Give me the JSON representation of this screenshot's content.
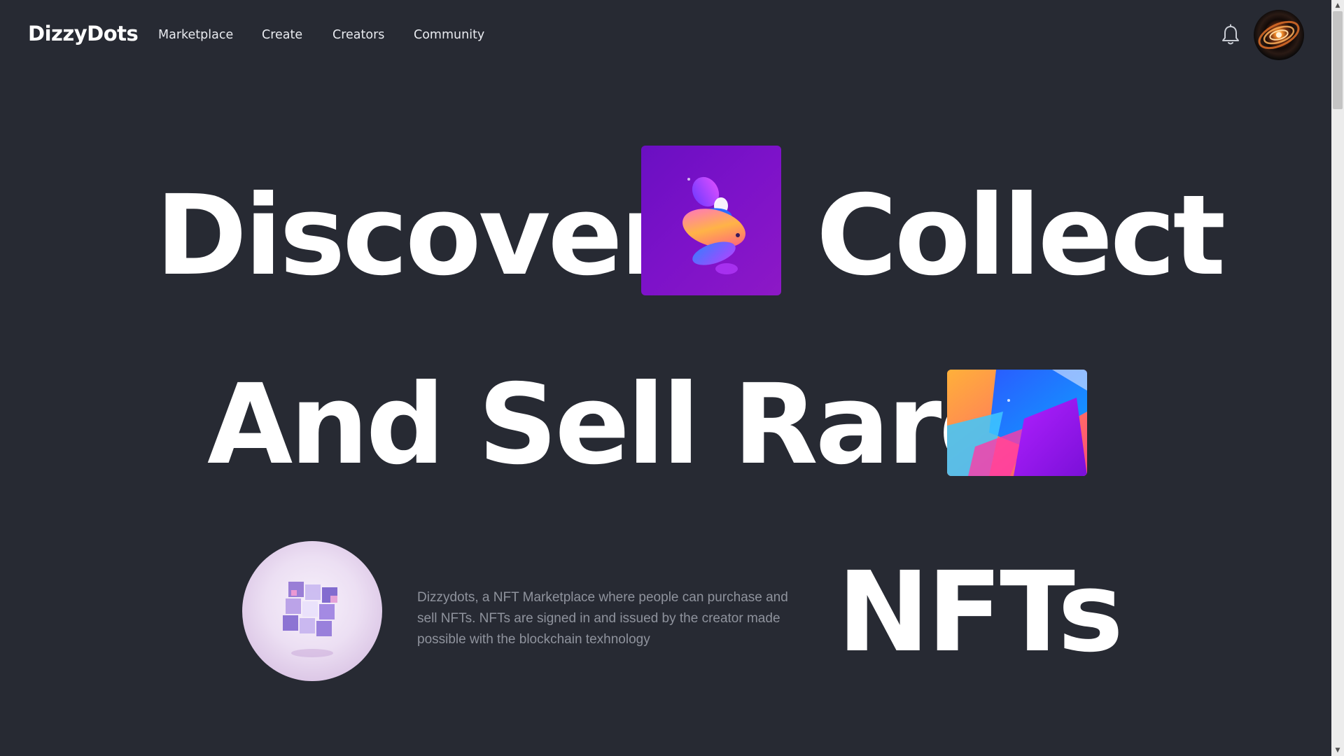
{
  "header": {
    "brand": "DizzyDots",
    "nav": [
      {
        "label": "Marketplace"
      },
      {
        "label": "Create"
      },
      {
        "label": "Creators"
      },
      {
        "label": "Community"
      }
    ],
    "notification_icon": "bell-icon",
    "avatar_icon": "galaxy-avatar"
  },
  "hero": {
    "line1_word1": "Discover",
    "line1_word2": "Collect",
    "line2_words": "And Sell Rare",
    "line3_word": "NFTs",
    "description": "Dizzydots, a NFT Marketplace where people can purchase and sell NFTs. NFTs are signed in and issued by the creator made possible with the blockchain texhnology"
  },
  "colors": {
    "background": "#272a33",
    "text": "#ffffff",
    "muted_text": "#8f939d",
    "accent_purple": "#7a12c8"
  }
}
